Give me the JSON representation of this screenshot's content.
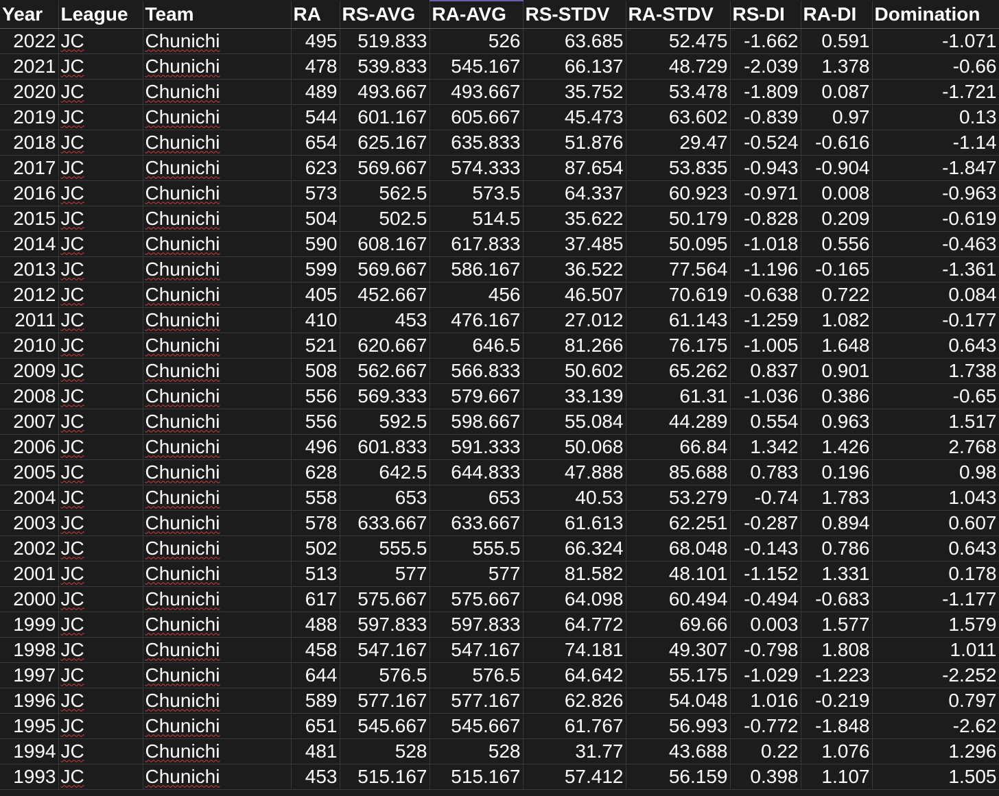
{
  "headers": [
    "Year",
    "League",
    "Team",
    "RA",
    "RS-AVG",
    "RA-AVG",
    "RS-STDV",
    "RA-STDV",
    "RS-DI",
    "RA-DI",
    "Domination"
  ],
  "rows": [
    [
      "2022",
      "JC",
      "Chunichi",
      "495",
      "519.833",
      "526",
      "63.685",
      "52.475",
      "-1.662",
      "0.591",
      "-1.071"
    ],
    [
      "2021",
      "JC",
      "Chunichi",
      "478",
      "539.833",
      "545.167",
      "66.137",
      "48.729",
      "-2.039",
      "1.378",
      "-0.66"
    ],
    [
      "2020",
      "JC",
      "Chunichi",
      "489",
      "493.667",
      "493.667",
      "35.752",
      "53.478",
      "-1.809",
      "0.087",
      "-1.721"
    ],
    [
      "2019",
      "JC",
      "Chunichi",
      "544",
      "601.167",
      "605.667",
      "45.473",
      "63.602",
      "-0.839",
      "0.97",
      "0.13"
    ],
    [
      "2018",
      "JC",
      "Chunichi",
      "654",
      "625.167",
      "635.833",
      "51.876",
      "29.47",
      "-0.524",
      "-0.616",
      "-1.14"
    ],
    [
      "2017",
      "JC",
      "Chunichi",
      "623",
      "569.667",
      "574.333",
      "87.654",
      "53.835",
      "-0.943",
      "-0.904",
      "-1.847"
    ],
    [
      "2016",
      "JC",
      "Chunichi",
      "573",
      "562.5",
      "573.5",
      "64.337",
      "60.923",
      "-0.971",
      "0.008",
      "-0.963"
    ],
    [
      "2015",
      "JC",
      "Chunichi",
      "504",
      "502.5",
      "514.5",
      "35.622",
      "50.179",
      "-0.828",
      "0.209",
      "-0.619"
    ],
    [
      "2014",
      "JC",
      "Chunichi",
      "590",
      "608.167",
      "617.833",
      "37.485",
      "50.095",
      "-1.018",
      "0.556",
      "-0.463"
    ],
    [
      "2013",
      "JC",
      "Chunichi",
      "599",
      "569.667",
      "586.167",
      "36.522",
      "77.564",
      "-1.196",
      "-0.165",
      "-1.361"
    ],
    [
      "2012",
      "JC",
      "Chunichi",
      "405",
      "452.667",
      "456",
      "46.507",
      "70.619",
      "-0.638",
      "0.722",
      "0.084"
    ],
    [
      "2011",
      "JC",
      "Chunichi",
      "410",
      "453",
      "476.167",
      "27.012",
      "61.143",
      "-1.259",
      "1.082",
      "-0.177"
    ],
    [
      "2010",
      "JC",
      "Chunichi",
      "521",
      "620.667",
      "646.5",
      "81.266",
      "76.175",
      "-1.005",
      "1.648",
      "0.643"
    ],
    [
      "2009",
      "JC",
      "Chunichi",
      "508",
      "562.667",
      "566.833",
      "50.602",
      "65.262",
      "0.837",
      "0.901",
      "1.738"
    ],
    [
      "2008",
      "JC",
      "Chunichi",
      "556",
      "569.333",
      "579.667",
      "33.139",
      "61.31",
      "-1.036",
      "0.386",
      "-0.65"
    ],
    [
      "2007",
      "JC",
      "Chunichi",
      "556",
      "592.5",
      "598.667",
      "55.084",
      "44.289",
      "0.554",
      "0.963",
      "1.517"
    ],
    [
      "2006",
      "JC",
      "Chunichi",
      "496",
      "601.833",
      "591.333",
      "50.068",
      "66.84",
      "1.342",
      "1.426",
      "2.768"
    ],
    [
      "2005",
      "JC",
      "Chunichi",
      "628",
      "642.5",
      "644.833",
      "47.888",
      "85.688",
      "0.783",
      "0.196",
      "0.98"
    ],
    [
      "2004",
      "JC",
      "Chunichi",
      "558",
      "653",
      "653",
      "40.53",
      "53.279",
      "-0.74",
      "1.783",
      "1.043"
    ],
    [
      "2003",
      "JC",
      "Chunichi",
      "578",
      "633.667",
      "633.667",
      "61.613",
      "62.251",
      "-0.287",
      "0.894",
      "0.607"
    ],
    [
      "2002",
      "JC",
      "Chunichi",
      "502",
      "555.5",
      "555.5",
      "66.324",
      "68.048",
      "-0.143",
      "0.786",
      "0.643"
    ],
    [
      "2001",
      "JC",
      "Chunichi",
      "513",
      "577",
      "577",
      "81.582",
      "48.101",
      "-1.152",
      "1.331",
      "0.178"
    ],
    [
      "2000",
      "JC",
      "Chunichi",
      "617",
      "575.667",
      "575.667",
      "64.098",
      "60.494",
      "-0.494",
      "-0.683",
      "-1.177"
    ],
    [
      "1999",
      "JC",
      "Chunichi",
      "488",
      "597.833",
      "597.833",
      "64.772",
      "69.66",
      "0.003",
      "1.577",
      "1.579"
    ],
    [
      "1998",
      "JC",
      "Chunichi",
      "458",
      "547.167",
      "547.167",
      "74.181",
      "49.307",
      "-0.798",
      "1.808",
      "1.011"
    ],
    [
      "1997",
      "JC",
      "Chunichi",
      "644",
      "576.5",
      "576.5",
      "64.642",
      "55.175",
      "-1.029",
      "-1.223",
      "-2.252"
    ],
    [
      "1996",
      "JC",
      "Chunichi",
      "589",
      "577.167",
      "577.167",
      "62.826",
      "54.048",
      "1.016",
      "-0.219",
      "0.797"
    ],
    [
      "1995",
      "JC",
      "Chunichi",
      "651",
      "545.667",
      "545.667",
      "61.767",
      "56.993",
      "-0.772",
      "-1.848",
      "-2.62"
    ],
    [
      "1994",
      "JC",
      "Chunichi",
      "481",
      "528",
      "528",
      "31.77",
      "43.688",
      "0.22",
      "1.076",
      "1.296"
    ],
    [
      "1993",
      "JC",
      "Chunichi",
      "453",
      "515.167",
      "515.167",
      "57.412",
      "56.159",
      "0.398",
      "1.107",
      "1.505"
    ]
  ]
}
